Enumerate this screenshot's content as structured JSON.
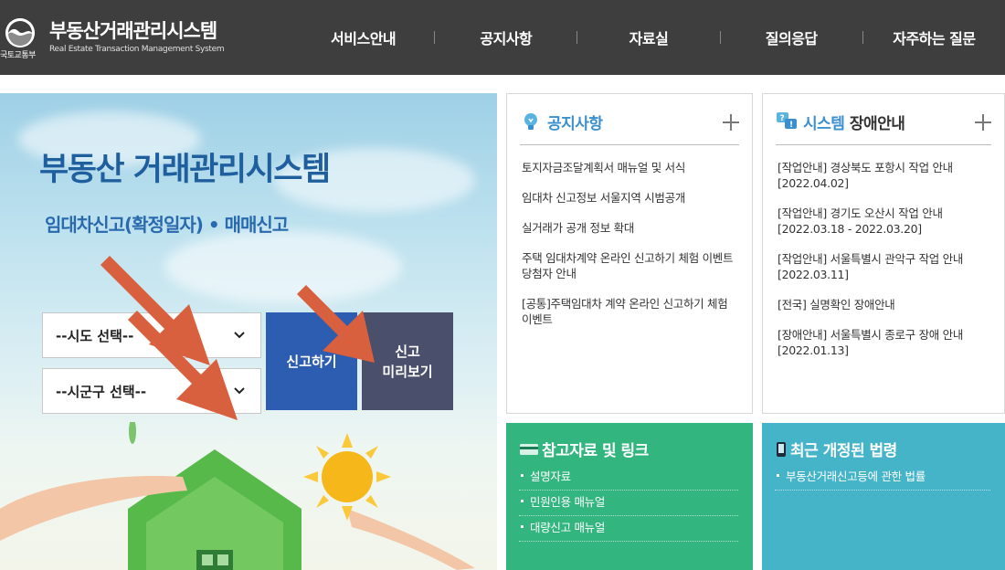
{
  "header": {
    "ministry": "국토교통부",
    "title": "부동산거래관리시스템",
    "subtitle": "Real Estate Transaction Management System",
    "nav": [
      "서비스안내",
      "공지사항",
      "자료실",
      "질의응답",
      "자주하는 질문"
    ]
  },
  "hero": {
    "title": "부동산 거래관리시스템",
    "subtitle": "임대차신고(확정일자) • 매매신고",
    "select_sido": "--시도 선택--",
    "select_sigungu": "--시군구 선택--",
    "btn_report": "신고하기",
    "btn_preview_line1": "신고",
    "btn_preview_line2": "미리보기",
    "arrow_color": "#d9603e"
  },
  "notice": {
    "title": "공지사항",
    "items": [
      "토지자금조달계획서 매뉴얼 및 서식",
      "임대차 신고정보 서울지역 시범공개",
      "실거래가 공개 정보 확대",
      "주택 임대차계약 온라인 신고하기 체험 이벤트 당첨자 안내",
      "[공통]주택임대차 계약 온라인 신고하기 체험 이벤트"
    ]
  },
  "outage": {
    "title_blue": "시스템",
    "title_dark": "장애안내",
    "items": [
      "[작업안내] 경상북도 포항시 작업 안내 [2022.04.02]",
      "[작업안내] 경기도 오산시 작업 안내 [2022.03.18 - 2022.03.20]",
      "[작업안내] 서울특별시 관악구 작업 안내 [2022.03.11]",
      "[전국] 실명확인 장애안내",
      "[장애안내] 서울특별시 종로구 장애 안내 [2022.01.13]"
    ]
  },
  "refs": {
    "title": "참고자료 및 링크",
    "items": [
      "설명자료",
      "민원인용 매뉴얼",
      "대량신고 매뉴얼"
    ]
  },
  "laws": {
    "title": "최근 개정된 법령",
    "items": [
      "부동산거래신고등에 관한 법률"
    ]
  },
  "colors": {
    "header_bg": "#3e3e3e",
    "accent_blue": "#3a8fce",
    "report_btn": "#2d5db0",
    "preview_btn": "#4a4f6b",
    "green_box": "#33b57f",
    "teal_box": "#45b4c9"
  }
}
